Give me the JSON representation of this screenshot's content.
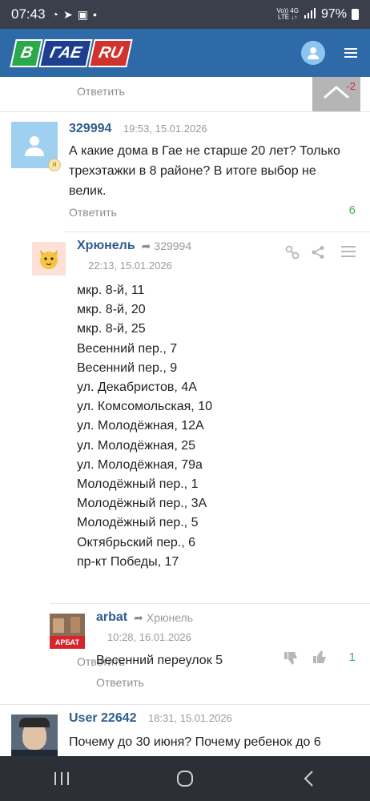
{
  "statusbar": {
    "time": "07:43",
    "battery": "97%",
    "net_top": "Vo)) 4G",
    "net_bottom": "LTE ↓↑"
  },
  "header": {
    "logo_b": "В",
    "logo_gae": "ГАЕ",
    "logo_ru": "RU"
  },
  "top_reply": {
    "reply_label": "Ответить",
    "score": "-2"
  },
  "comments": [
    {
      "author": "329994",
      "date": "19:53, 15.01.2026",
      "text": "А какие дома в Гае не старше 20 лет? Только трехэтажки в 8 районе?  В итоге выбор не велик.",
      "reply_label": "Ответить",
      "score": "6"
    },
    {
      "author": "Хрюнель",
      "reply_to": "329994",
      "date": "22:13, 15.01.2026",
      "addresses": [
        "мкр. 8-й, 11",
        "мкр. 8-й, 20",
        "мкр. 8-й, 25",
        "Весенний пер., 7",
        "Весенний пер., 9",
        "ул. Декабристов, 4А",
        "ул. Комсомольская, 10",
        "ул. Молодёжная, 12А",
        "ул. Молодёжная, 25",
        "ул. Молодёжная, 79а",
        "Молодёжный пер., 1",
        "Молодёжный пер., 3А",
        "Молодёжный пер., 5",
        "Октябрьский пер., 6",
        "пр-кт Победы, 17"
      ],
      "reply_label": "Ответить",
      "score": "1"
    },
    {
      "author": "arbat",
      "reply_to": "Хрюнель",
      "date": "10:28, 16.01.2026",
      "avatar_text": "АРБАТ",
      "text": "Весенний переулок 5",
      "reply_label": "Ответить"
    },
    {
      "author": "User 22642",
      "date": "18:31, 15.01.2026",
      "text": "Почему до 30 июня? Почему ребенок до 6"
    }
  ],
  "colors": {
    "accent": "#2f6aa8",
    "author": "#2f5e8e",
    "positive": "#3cb55a",
    "negative": "#dd2233"
  }
}
